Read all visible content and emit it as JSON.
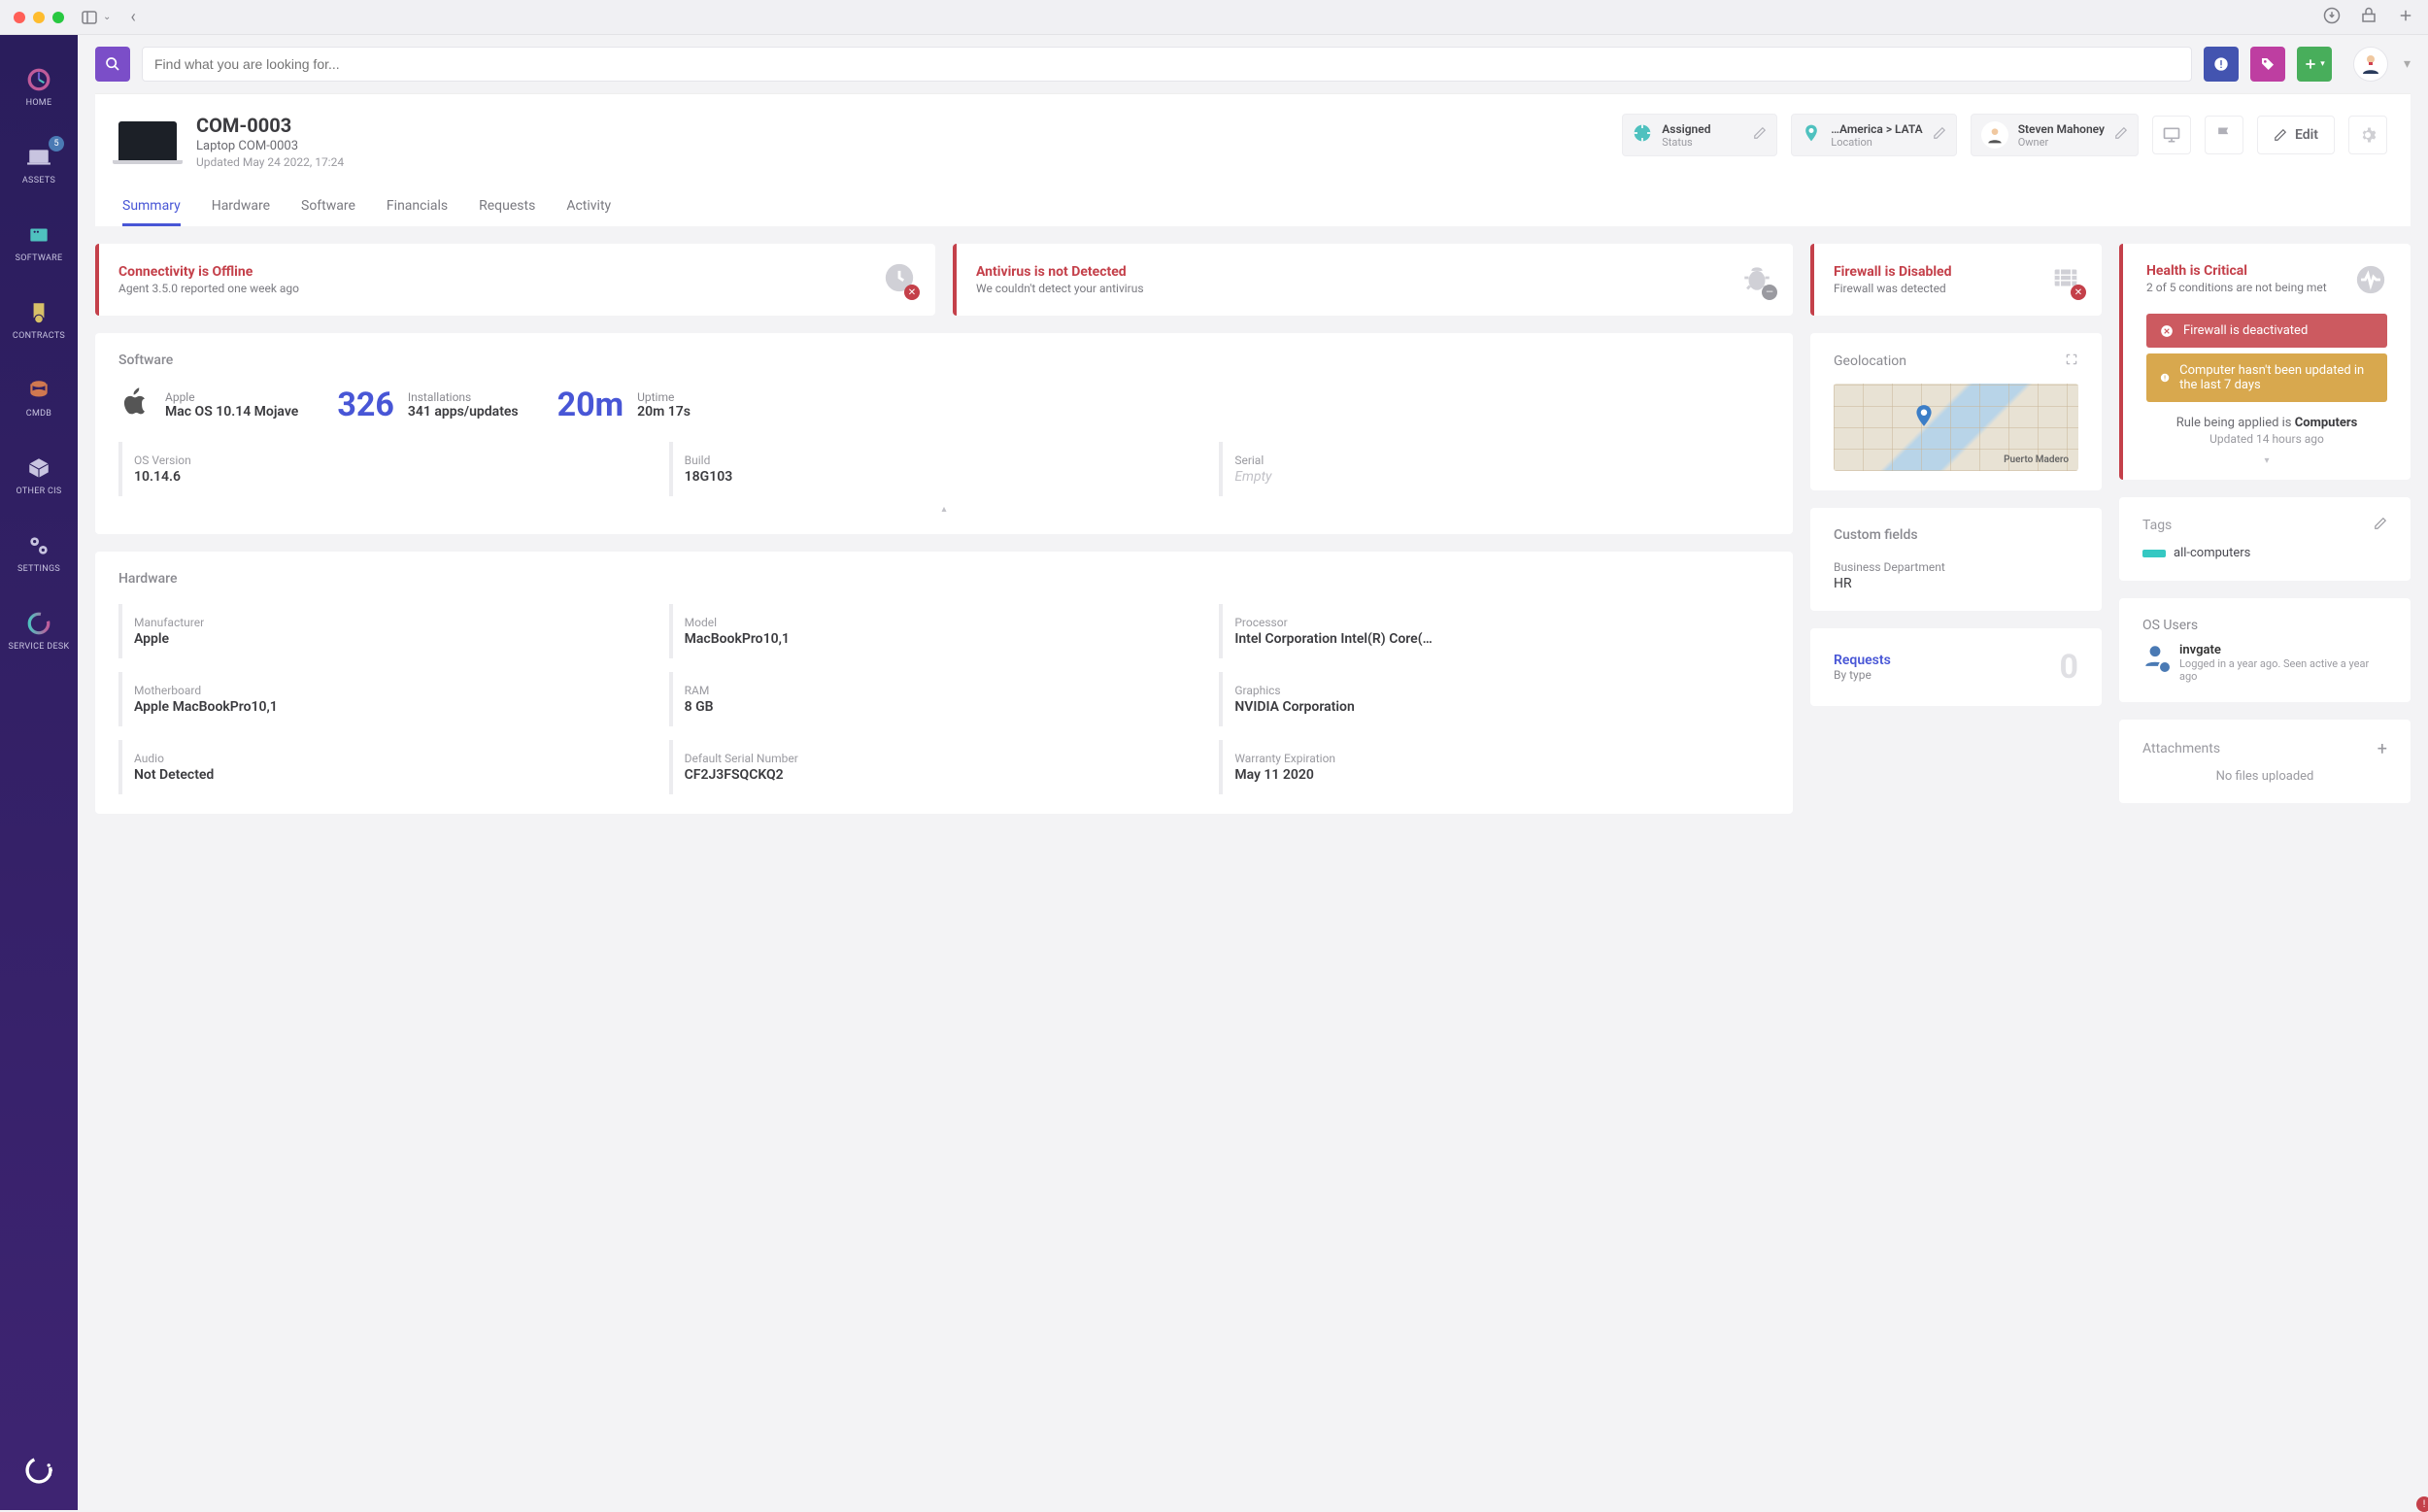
{
  "window": {
    "title": "COM-0003"
  },
  "sidebar": {
    "items": [
      {
        "label": "HOME"
      },
      {
        "label": "ASSETS",
        "badge": "5"
      },
      {
        "label": "SOFTWARE"
      },
      {
        "label": "CONTRACTS"
      },
      {
        "label": "CMDB"
      },
      {
        "label": "OTHER CIs"
      },
      {
        "label": "SETTINGS"
      },
      {
        "label": "SERVICE DESK"
      }
    ]
  },
  "search": {
    "placeholder": "Find what you are looking for..."
  },
  "asset": {
    "id": "COM-0003",
    "name": "Laptop COM-0003",
    "updated": "Updated May 24 2022, 17:24",
    "status": {
      "title": "Assigned",
      "sub": "Status"
    },
    "location": {
      "title": "…America > LATA",
      "sub": "Location"
    },
    "owner": {
      "title": "Steven Mahoney",
      "sub": "Owner"
    },
    "edit_label": "Edit"
  },
  "tabs": [
    "Summary",
    "Hardware",
    "Software",
    "Financials",
    "Requests",
    "Activity"
  ],
  "alerts": [
    {
      "title": "Connectivity is Offline",
      "sub": "Agent 3.5.0 reported one week ago"
    },
    {
      "title": "Antivirus is not Detected",
      "sub": "We couldn't detect your antivirus"
    },
    {
      "title": "Firewall is Disabled",
      "sub": "Firewall was detected"
    }
  ],
  "health": {
    "title": "Health is Critical",
    "sub": "2 of 5 conditions are not being met",
    "banners": [
      {
        "kind": "red",
        "text": "Firewall is deactivated"
      },
      {
        "kind": "yellow",
        "text": "Computer hasn't been updated in the last 7 days"
      }
    ],
    "rule_prefix": "Rule being applied is ",
    "rule_name": "Computers",
    "rule_updated": "Updated 14 hours ago"
  },
  "software": {
    "heading": "Software",
    "os_label": "Apple",
    "os_name": "Mac OS 10.14 Mojave",
    "install_count": "326",
    "install_label": "Installations",
    "install_sub": "341 apps/updates",
    "uptime_big": "20m",
    "uptime_label": "Uptime",
    "uptime_sub": "20m 17s",
    "fields": [
      {
        "label": "OS Version",
        "value": "10.14.6"
      },
      {
        "label": "Build",
        "value": "18G103"
      },
      {
        "label": "Serial",
        "value": "Empty",
        "empty": true
      }
    ]
  },
  "hardware": {
    "heading": "Hardware",
    "fields": [
      {
        "label": "Manufacturer",
        "value": "Apple"
      },
      {
        "label": "Model",
        "value": "MacBookPro10,1"
      },
      {
        "label": "Processor",
        "value": "Intel Corporation Intel(R) Core(…"
      },
      {
        "label": "Motherboard",
        "value": "Apple MacBookPro10,1"
      },
      {
        "label": "RAM",
        "value": "8 GB"
      },
      {
        "label": "Graphics",
        "value": "NVIDIA Corporation"
      },
      {
        "label": "Audio",
        "value": "Not Detected"
      },
      {
        "label": "Default Serial Number",
        "value": "CF2J3FSQCKQ2"
      },
      {
        "label": "Warranty Expiration",
        "value": "May 11 2020"
      }
    ]
  },
  "geolocation": {
    "heading": "Geolocation",
    "place": "Puerto Madero"
  },
  "custom_fields": {
    "heading": "Custom fields",
    "label": "Business Department",
    "value": "HR"
  },
  "requests": {
    "title": "Requests",
    "sub": "By type",
    "count": "0"
  },
  "tags": {
    "heading": "Tags",
    "items": [
      "all-computers"
    ]
  },
  "os_users": {
    "heading": "OS Users",
    "name": "invgate",
    "detail": "Logged in a year ago. Seen active a year ago"
  },
  "attachments": {
    "heading": "Attachments",
    "empty": "No files uploaded"
  }
}
